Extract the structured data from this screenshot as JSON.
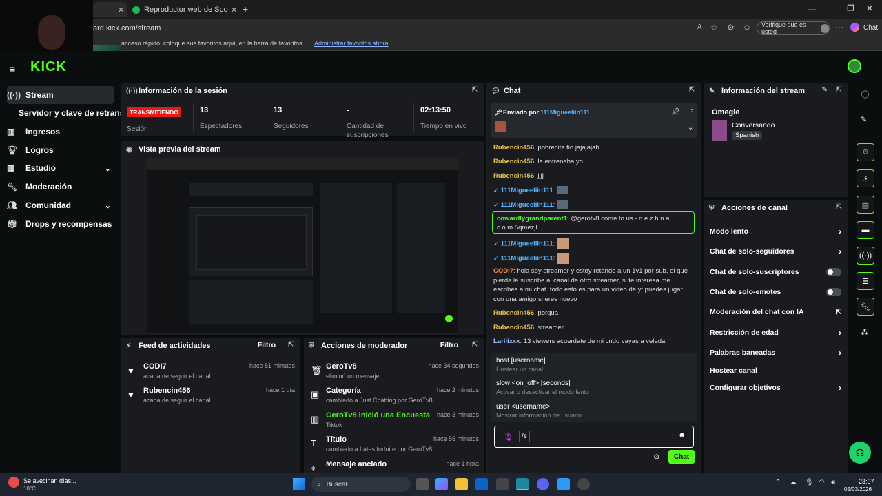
{
  "browser": {
    "tab_title": "Reproductor web de Spotify: músi",
    "address": "ard.kick.com/stream",
    "fav_text": "acceso rápido, coloque sus favoritos aquí, en la barra de favoritos.",
    "fav_link": "Administrar favoritos ahora",
    "verify_label": "Verifique que es usted",
    "copilot_label": "Chat"
  },
  "sidebar": {
    "logo": "KICK",
    "items": [
      {
        "label": "Stream",
        "icon": "broadcast-icon"
      },
      {
        "label": "Servidor y clave de retransm",
        "icon": ""
      },
      {
        "label": "Ingresos",
        "icon": "chart-icon"
      },
      {
        "label": "Logros",
        "icon": "trophy-icon"
      },
      {
        "label": "Estudio",
        "icon": "grid-icon"
      },
      {
        "label": "Moderación",
        "icon": "wrench-icon"
      },
      {
        "label": "Comunidad",
        "icon": "users-icon"
      },
      {
        "label": "Drops y recompensas",
        "icon": "gift-icon"
      }
    ]
  },
  "session": {
    "title": "Información de la sesión",
    "status_badge": "TRANSMITIENDO",
    "status_label": "Sesión",
    "stats": [
      {
        "value": "13",
        "label": "Espectadores"
      },
      {
        "value": "13",
        "label": "Seguidores"
      },
      {
        "value": "-",
        "label": "Cantidad de suscripciones"
      },
      {
        "value": "02:13:50",
        "label": "Tiempo en vivo"
      }
    ]
  },
  "preview": {
    "title": "Vista previa del stream"
  },
  "activity": {
    "title": "Feed de actividades",
    "filter": "Filtro",
    "items": [
      {
        "name": "CODI7",
        "sub": "acaba de seguir el canal",
        "time": "hace 51 minutos"
      },
      {
        "name": "Rubencin456",
        "sub": "acaba de seguir el canal",
        "time": "hace 1 día"
      }
    ]
  },
  "modactions": {
    "title": "Acciones de moderador",
    "filter": "Filtro",
    "items": [
      {
        "name": "GeroTv8",
        "sub": "eliminó un mensaje",
        "time": "hace 34 segundos"
      },
      {
        "name": "Categoría",
        "sub": "cambiado a Just Chatting por GeroTv8",
        "time": "hace 2 minutos"
      },
      {
        "name": "GeroTv8 inició una Encuesta",
        "sub": "Tiktok",
        "time": "hace 3 minutos"
      },
      {
        "name": "Título",
        "sub": "cambiado a Lates fortnite por GeroTv8",
        "time": "hace 55 minutos"
      },
      {
        "name": "Mensaje anclado",
        "sub": "",
        "time": "hace 1 hora"
      }
    ]
  },
  "chat": {
    "title": "Chat",
    "pinned_label": "Enviado por",
    "pinned_user": "111Migueeliin111",
    "messages": [
      {
        "user": "Rubencin456",
        "text": ": pobrecita tio jajajajab"
      },
      {
        "user": "Rubencin456",
        "text": ": le entrenaba yo"
      },
      {
        "user": "Rubencin456",
        "text": ": jjjj"
      },
      {
        "user": "111Migueeliin111",
        "text": ":"
      },
      {
        "user": "111Migueeliin111",
        "text": ":"
      },
      {
        "user": "cowardlygrandparent1",
        "text": ": @gerotv8 come to us - n.e.z.h.n.a . c.o.m 5qmezjl"
      },
      {
        "user": "111Migueeliin111",
        "text": ":"
      },
      {
        "user": "111Migueeliin111",
        "text": ":"
      },
      {
        "user": "CODI7",
        "text": ": hola soy streamer y estoy retando a un 1v1 por sub, el que pierda le suscribe al canal de otro streamer, si te interesa me escribes a mi chat. todo esto es para un video de yt puedes jugar con una amigo si eres nuevo"
      },
      {
        "user": "Rubencin456",
        "text": ": porqua"
      },
      {
        "user": "Rubencin456",
        "text": ": streamer"
      },
      {
        "user": "Lariiixxx",
        "text": ": 13 viewers acuerdate de mi cndo vayas a velada"
      }
    ],
    "commands": [
      {
        "cmd": "host [username]",
        "desc": "Hostear un canal"
      },
      {
        "cmd": "slow <on_off> [seconds]",
        "desc": "Activar o desactivar el modo lento"
      },
      {
        "cmd": "user <username>",
        "desc": "Mostrar información de usuario"
      }
    ],
    "input_value": "/s",
    "send_label": "Chat"
  },
  "streaminfo": {
    "title": "Información del stream",
    "stream_title": "Omegle",
    "category": "Conversando",
    "language": "Spanish"
  },
  "channelactions": {
    "title": "Acciones de canal",
    "items": [
      {
        "label": "Modo lento",
        "control": "chevron"
      },
      {
        "label": "Chat de solo-seguidores",
        "control": "chevron"
      },
      {
        "label": "Chat de solo-suscriptores",
        "control": "toggle"
      },
      {
        "label": "Chat de solo-emotes",
        "control": "toggle"
      },
      {
        "label": "Moderación del chat con IA",
        "control": "external"
      },
      {
        "label": "Restricción de edad",
        "control": "chevron"
      },
      {
        "label": "Palabras baneadas",
        "control": "chevron"
      },
      {
        "label": "Hostear canal",
        "control": "none"
      },
      {
        "label": "Configurar objetivos",
        "control": "chevron"
      }
    ]
  },
  "taskbar": {
    "weather_title": "Se avecinan días...",
    "weather_temp": "10°C",
    "search": "Buscar",
    "time": "23:07",
    "date": "05/03/2026"
  },
  "colors": {
    "accent": "#53fc18",
    "live": "#e91916",
    "username": "#e5c14a",
    "link": "#53b4ff"
  }
}
